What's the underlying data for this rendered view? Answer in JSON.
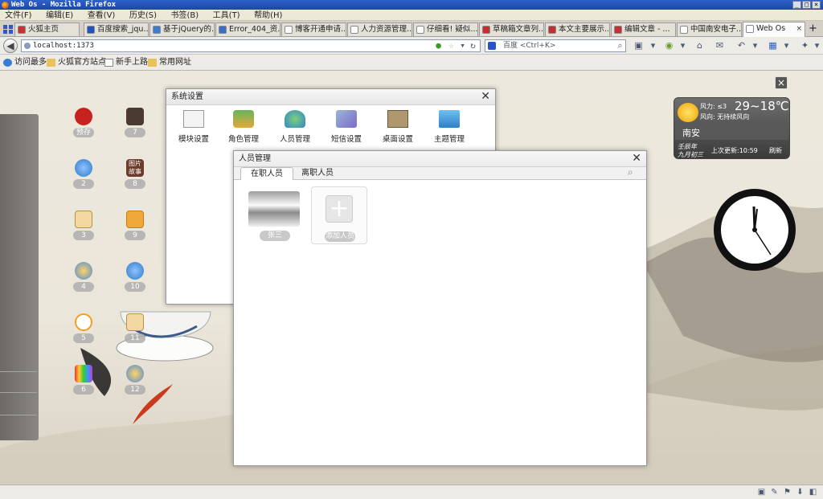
{
  "window": {
    "title": "Web Os - Mozilla Firefox",
    "buttons": [
      "_",
      "□",
      "×"
    ]
  },
  "menu": [
    "文件(F)",
    "编辑(E)",
    "查看(V)",
    "历史(S)",
    "书签(B)",
    "工具(T)",
    "帮助(H)"
  ],
  "tabs": [
    {
      "label": "火狐主页",
      "color": "#c9332b"
    },
    {
      "label": "百度搜索_jqu...",
      "color": "#2352c6"
    },
    {
      "label": "基于jQuery的...",
      "color": "#3d7bd4"
    },
    {
      "label": "Error_404_资...",
      "color": "#3b6fc6"
    },
    {
      "label": "博客开通申请...",
      "color": "#ffffff"
    },
    {
      "label": "人力资源管理...",
      "color": "#ffffff"
    },
    {
      "label": "仔细看! 疑似...",
      "color": "#ffffff"
    },
    {
      "label": "草稿箱文章列...",
      "color": "#c62f2f"
    },
    {
      "label": "本文主要展示...",
      "color": "#c62f2f"
    },
    {
      "label": "编辑文章 - ...",
      "color": "#c62f2f"
    },
    {
      "label": "中国南安电子...",
      "color": "#ffffff"
    },
    {
      "label": "Web Os",
      "color": "#ffffff"
    }
  ],
  "nav": {
    "url": "localhost:1373",
    "search_engine": "百度",
    "search_placeholder": "百度 <Ctrl+K>"
  },
  "bookmarks": [
    "访问最多",
    "火狐官方站点",
    "新手上路",
    "常用网址"
  ],
  "desktop_icons": [
    {
      "label": "预存",
      "color": "#c8221f"
    },
    {
      "label": "7",
      "color": "#4a3b30"
    },
    {
      "label": "2",
      "color": "#2e78c7"
    },
    {
      "label": "8",
      "color": "#6d3b2a",
      "text": "图片\n故事"
    },
    {
      "label": "3",
      "color": "#e9c27a"
    },
    {
      "label": "9",
      "color": "#f0a83a"
    },
    {
      "label": "4",
      "color": "#e9b33a"
    },
    {
      "label": "10",
      "color": "#2e78c7"
    },
    {
      "label": "5",
      "color": "#f0a020"
    },
    {
      "label": "11",
      "color": "#e9c27a"
    },
    {
      "label": "6",
      "color": "#d03a8a"
    },
    {
      "label": "12",
      "color": "#e9b33a"
    }
  ],
  "system_window": {
    "title": "系统设置",
    "items": [
      "模块设置",
      "角色管理",
      "人员管理",
      "短信设置",
      "桌面设置",
      "主题管理"
    ]
  },
  "personnel_window": {
    "title": "人员管理",
    "tabs": [
      "在职人员",
      "离职人员"
    ],
    "cards": [
      "张三",
      "添加人员"
    ]
  },
  "weather": {
    "wind_power": "风力: ≤3",
    "wind_direction": "风向: 无持续风向",
    "temperature": "29~18℃",
    "city": "南安",
    "lunar_line1": "壬辰年",
    "lunar_line2": "九月初三",
    "updated": "上次更新:10:59",
    "refresh": "刷新"
  }
}
